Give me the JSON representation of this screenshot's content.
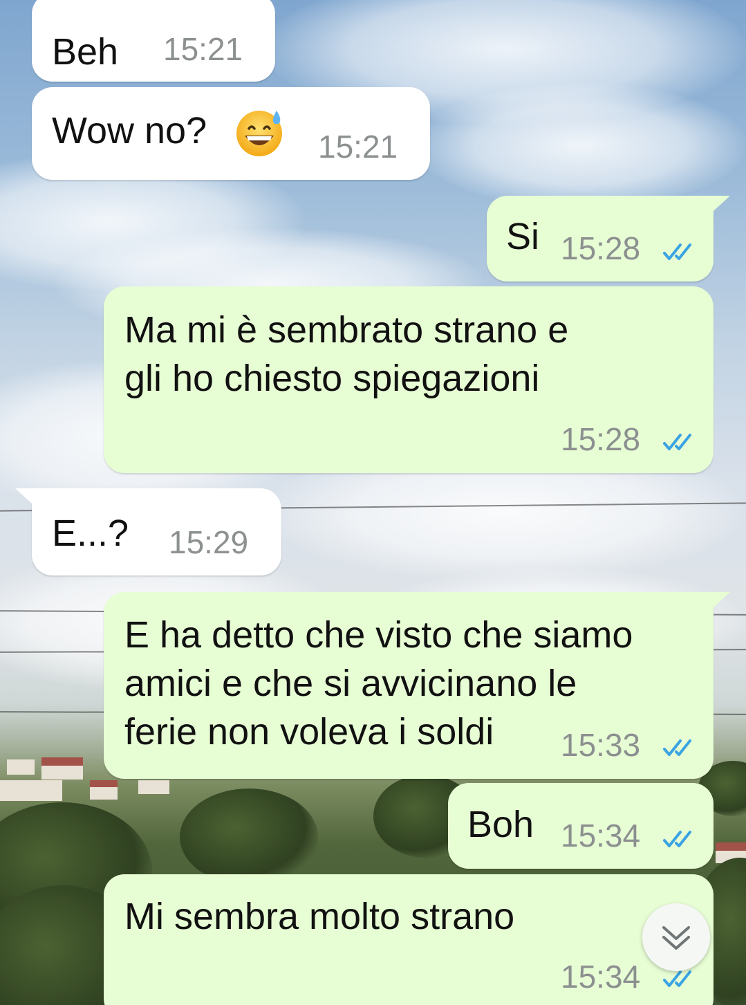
{
  "messages": [
    {
      "direction": "incoming",
      "text": "Beh",
      "time": "15:21"
    },
    {
      "direction": "incoming",
      "text": "Wow no?",
      "emoji": "grinning-face-with-sweat",
      "time": "15:21"
    },
    {
      "direction": "outgoing",
      "text": "Si",
      "time": "15:28",
      "status": "read-double-check"
    },
    {
      "direction": "outgoing",
      "lines": [
        "Ma mi è sembrato strano e",
        "gli ho chiesto spiegazioni"
      ],
      "time": "15:28",
      "status": "read-double-check"
    },
    {
      "direction": "incoming",
      "text": "E...?",
      "time": "15:29"
    },
    {
      "direction": "outgoing",
      "lines": [
        "E ha detto che visto che siamo",
        "amici e che si avvicinano le",
        "ferie non voleva i soldi"
      ],
      "time": "15:33",
      "status": "read-double-check"
    },
    {
      "direction": "outgoing",
      "text": "Boh",
      "time": "15:34",
      "status": "read-double-check"
    },
    {
      "direction": "outgoing",
      "text": "Mi sembra molto strano",
      "time": "15:34",
      "status": "read-double-check"
    }
  ],
  "scroll_button": {
    "icon": "double-chevron-down-icon"
  },
  "colors": {
    "incoming_bubble": "#ffffff",
    "outgoing_bubble": "#e7fdd4",
    "read_ticks": "#3aa3e3",
    "timestamp": "#8c9090"
  }
}
